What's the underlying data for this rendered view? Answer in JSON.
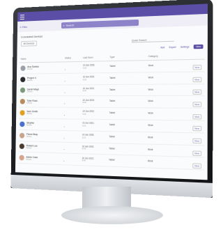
{
  "app": {
    "breadcrumb": "≡ Files",
    "search_label": "Search",
    "title": "Connected Devices",
    "filter": "All Devices",
    "quick_search": "Quick Search",
    "actions": [
      "Add",
      "Export",
      "Settings"
    ],
    "primary_action": "New"
  },
  "table": {
    "headers": [
      "Name",
      "Status",
      "Last Seen",
      "Type",
      "Category",
      ""
    ],
    "rows": [
      {
        "name": "Ana Santos",
        "sub": "Device",
        "status": "•",
        "date": "10 Jun 2021",
        "time": "9:23",
        "type": "Tablet",
        "category": "Work",
        "action": "View",
        "avatar": "#9aa1a8"
      },
      {
        "name": "Project X",
        "sub": "Device",
        "status": "•",
        "date": "10 Jun 2021",
        "time": "9:23",
        "type": "Tablet",
        "category": "Work",
        "action": "View",
        "avatar": "#2b2b2b"
      },
      {
        "name": "Sarah Mays",
        "sub": "Device",
        "status": "•",
        "date": "10 Jun 2021",
        "time": "9:23",
        "type": "Tablet",
        "category": "Work",
        "action": "View",
        "avatar": "#7a9a7a"
      },
      {
        "name": "Tyler Ross",
        "sub": "Device",
        "status": "•",
        "date": "10 Jun 2021",
        "time": "9:23",
        "type": "Tablet",
        "category": "Work",
        "action": "View",
        "avatar": "#b98a5a"
      },
      {
        "name": "Sam Smith",
        "sub": "Device",
        "status": "•",
        "date": "10 Jun 2021",
        "time": "9:23",
        "type": "Tablet",
        "category": "Work",
        "action": "View",
        "avatar": "#e0a020"
      },
      {
        "name": "Stephie",
        "sub": "Device",
        "status": "•",
        "date": "10 Jun 2021",
        "time": "9:23",
        "type": "Tablet",
        "category": "Work",
        "action": "View",
        "avatar": "#4a6fd0"
      },
      {
        "name": "Pierre Bray",
        "sub": "Device",
        "status": "•",
        "date": "10 Jun 2021",
        "time": "9:23",
        "type": "Tablet",
        "category": "Work",
        "action": "View",
        "avatar": "#c8a58a"
      },
      {
        "name": "Robert Lee",
        "sub": "Device",
        "status": "•",
        "date": "10 Jun 2021",
        "time": "9:23",
        "type": "Tablet",
        "category": "Work",
        "action": "View",
        "avatar": "#4d3b2e"
      },
      {
        "name": "Adele Coke",
        "sub": "Device",
        "status": "•",
        "date": "10 Jun 2021",
        "time": "9:23",
        "type": "Tablet",
        "category": "Work",
        "action": "View",
        "avatar": "#d6a48c"
      }
    ]
  }
}
